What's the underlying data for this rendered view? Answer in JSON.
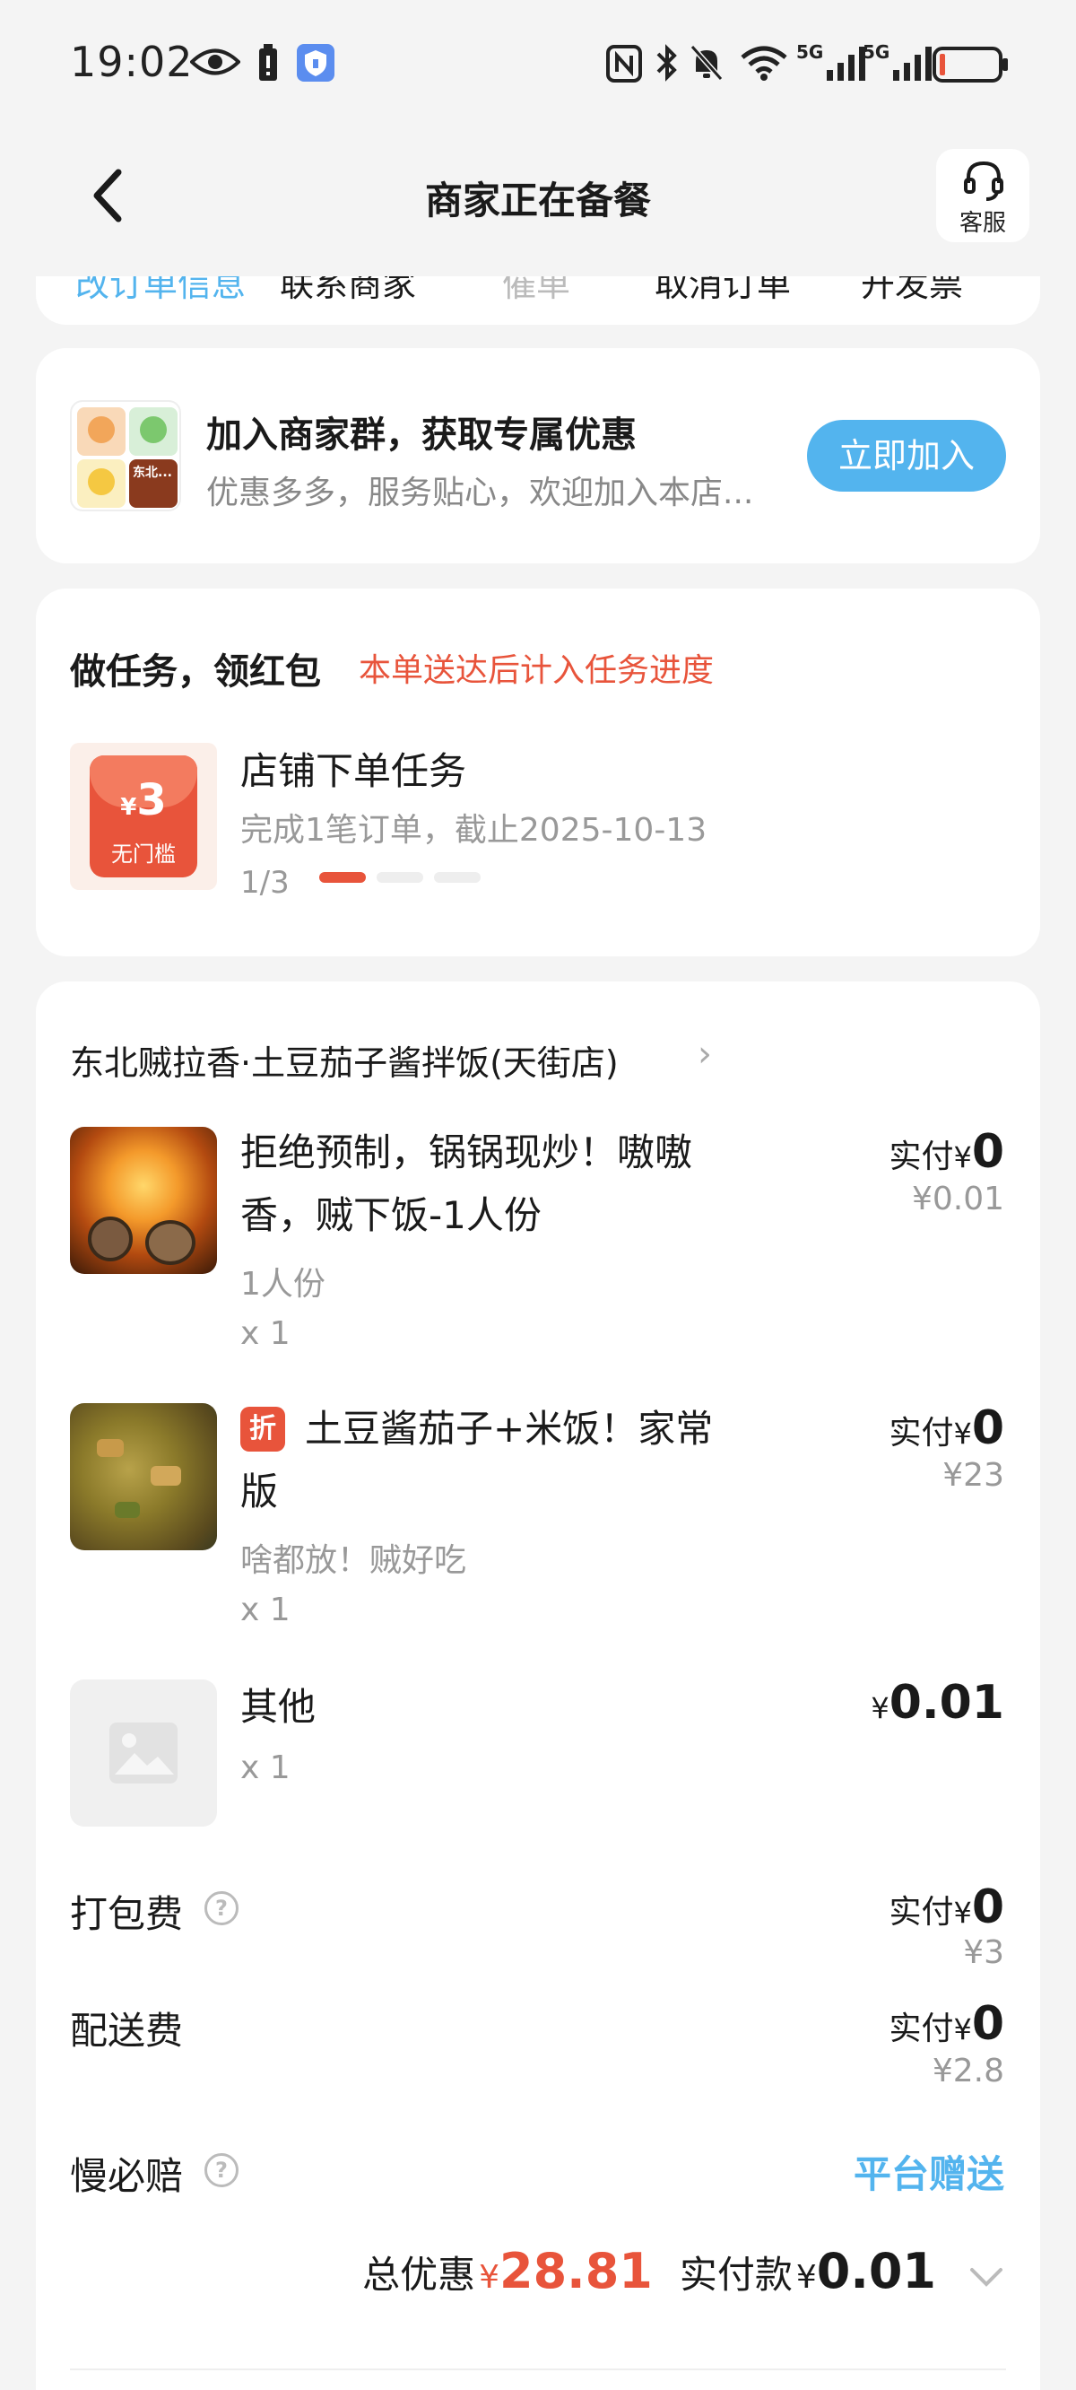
{
  "status_bar": {
    "time": "19:02",
    "icons": [
      "eye-icon",
      "battery-saver-icon",
      "vpn-icon",
      "nfc-icon",
      "bluetooth-icon",
      "mute-bell-icon",
      "wifi-icon",
      "signal-5g-icon",
      "signal-5g-icon",
      "battery-low-icon"
    ],
    "signal_labels": [
      "5G",
      "5G"
    ]
  },
  "header": {
    "title": "商家正在备餐",
    "service_label": "客服"
  },
  "top_actions": {
    "items": [
      "改订单信息",
      "联系商家",
      "催单",
      "取消订单",
      "开发票"
    ]
  },
  "join_group": {
    "title": "加入商家群，获取专属优惠",
    "subtitle": "优惠多多，服务贴心，欢迎加入本店...",
    "button": "立即加入",
    "logo_text": "东北..."
  },
  "task": {
    "title": "做任务，领红包",
    "note": "本单送达后计入任务进度",
    "coupon_amount": "3",
    "coupon_yen": "¥",
    "coupon_label": "无门槛",
    "name": "店铺下单任务",
    "desc": "完成1笔订单，截止2025-10-13",
    "progress_text": "1/3",
    "progress_done": 1,
    "progress_total": 3
  },
  "order": {
    "shop_name": "东北贼拉香·土豆茄子酱拌饭(天街店)",
    "items": [
      {
        "name": "拒绝预制，锅锅现炒！嗷嗷香，贼下饭-1人份",
        "spec": "1人份",
        "qty": "x 1",
        "paid_label": "实付",
        "yen": "¥",
        "paid": "0",
        "original": "¥0.01"
      },
      {
        "badge": "折",
        "name": "土豆酱茄子+米饭！家常版",
        "spec": "啥都放！贼好吃",
        "qty": "x 1",
        "paid_label": "实付",
        "yen": "¥",
        "paid": "0",
        "original": "¥23"
      },
      {
        "name": "其他",
        "qty": "x 1",
        "yen": "¥",
        "price": "0.01"
      }
    ],
    "fees": {
      "packing": {
        "label": "打包费",
        "paid_label": "实付",
        "yen": "¥",
        "paid": "0",
        "original": "¥3"
      },
      "delivery": {
        "label": "配送费",
        "paid_label": "实付",
        "yen": "¥",
        "paid": "0",
        "original": "¥2.8"
      },
      "slow_comp": {
        "label": "慢必赔",
        "value": "平台赠送"
      }
    },
    "summary": {
      "discount_label": "总优惠",
      "discount_yen": "¥",
      "discount": "28.81",
      "paid_label": "实付款",
      "paid_yen": "¥",
      "paid": "0.01"
    }
  },
  "colors": {
    "accent_blue": "#53b4ee",
    "accent_red": "#e8543b",
    "background": "#f4f4f4"
  }
}
